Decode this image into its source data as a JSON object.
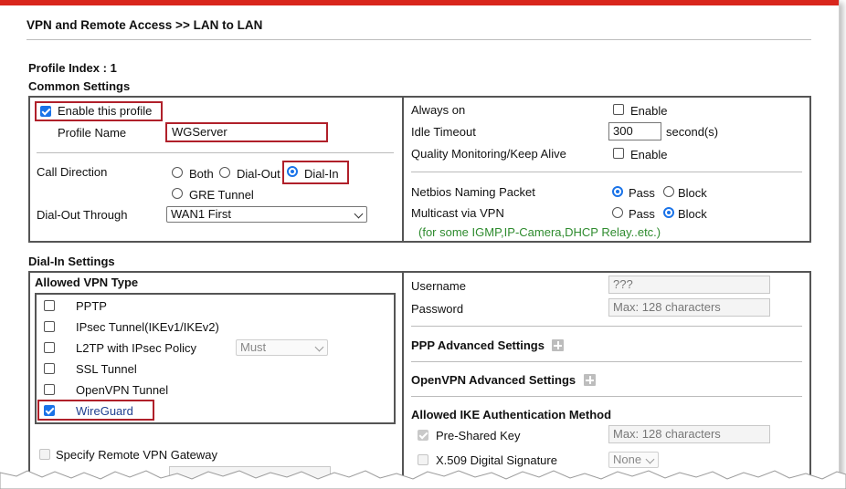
{
  "header": {
    "title": "VPN and Remote Access >> LAN to LAN"
  },
  "profile": {
    "index_label": "Profile Index : 1",
    "section_label": "Common Settings"
  },
  "common": {
    "enable_profile": {
      "label": "Enable this profile",
      "checked": true
    },
    "profile_name": {
      "label": "Profile Name",
      "value": "WGServer"
    },
    "call_direction": {
      "label": "Call Direction",
      "options": [
        "Both",
        "Dial-Out",
        "Dial-In",
        "GRE Tunnel"
      ],
      "selected": "Dial-In"
    },
    "dial_out_through": {
      "label": "Dial-Out Through",
      "value": "WAN1 First"
    },
    "always_on": {
      "label": "Always on",
      "option": "Enable",
      "checked": false
    },
    "idle_timeout": {
      "label": "Idle Timeout",
      "value": "300",
      "unit": "second(s)"
    },
    "quality_monitoring": {
      "label": "Quality Monitoring/Keep Alive",
      "option": "Enable",
      "checked": false
    },
    "netbios": {
      "label": "Netbios Naming Packet",
      "pass": "Pass",
      "block": "Block",
      "selected": "Pass"
    },
    "multicast": {
      "label": "Multicast via VPN",
      "pass": "Pass",
      "block": "Block",
      "selected": "Block",
      "note": "(for some IGMP,IP-Camera,DHCP Relay..etc.)"
    }
  },
  "dialin": {
    "section_label": "Dial-In Settings",
    "allowed_vpn_type": {
      "label": "Allowed VPN Type",
      "items": [
        {
          "label": "PPTP",
          "checked": false
        },
        {
          "label": "IPsec Tunnel(IKEv1/IKEv2)",
          "checked": false
        },
        {
          "label": "L2TP with IPsec Policy",
          "checked": false,
          "select": "Must"
        },
        {
          "label": "SSL Tunnel",
          "checked": false
        },
        {
          "label": "OpenVPN Tunnel",
          "checked": false
        },
        {
          "label": "WireGuard",
          "checked": true
        }
      ]
    },
    "specify_remote_gateway": {
      "label": "Specify Remote VPN Gateway",
      "checked": false
    },
    "username": {
      "label": "Username",
      "value": "???"
    },
    "password": {
      "label": "Password",
      "placeholder": "Max: 128 characters"
    },
    "ppp_advanced": {
      "label": "PPP Advanced Settings"
    },
    "openvpn_advanced": {
      "label": "OpenVPN Advanced Settings"
    },
    "ike_auth": {
      "label": "Allowed IKE Authentication Method",
      "psk": {
        "label": "Pre-Shared Key",
        "checked": true,
        "placeholder": "Max: 128 characters"
      },
      "x509": {
        "label": "X.509 Digital Signature",
        "checked": false,
        "select": "None"
      }
    }
  },
  "colors": {
    "accent_red": "#d9261c",
    "highlight": "#b0202a",
    "radio_blue": "#1a73e8",
    "note_green": "#2e8b2e"
  }
}
